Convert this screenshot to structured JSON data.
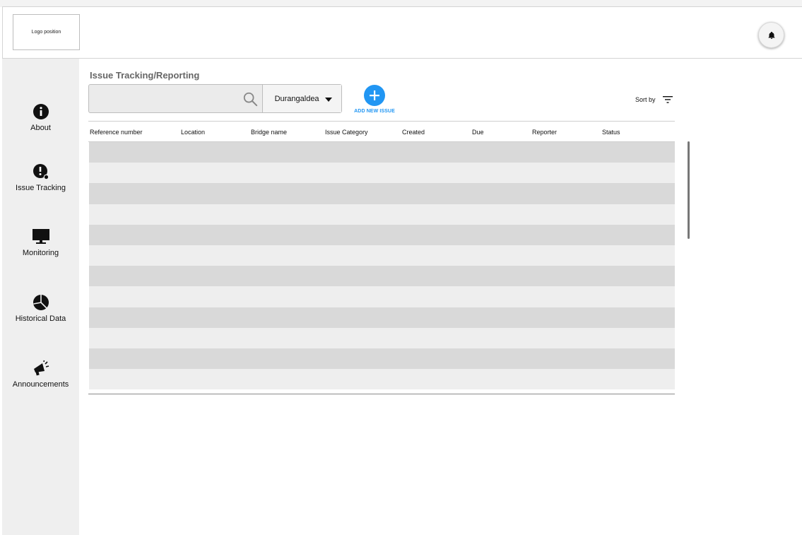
{
  "header": {
    "logo_text": "Logo position",
    "bell_icon": "bell-icon"
  },
  "sidebar": {
    "items": [
      {
        "label": "About",
        "icon": "info-icon"
      },
      {
        "label": "Issue Tracking",
        "icon": "issue-tracking-icon"
      },
      {
        "label": "Monitoring",
        "icon": "monitor-icon"
      },
      {
        "label": "Historical Data",
        "icon": "pie-chart-icon"
      },
      {
        "label": "Announcements",
        "icon": "megaphone-icon"
      }
    ]
  },
  "main": {
    "title": "Issue Tracking/Reporting",
    "search": {
      "value": "",
      "placeholder": "",
      "icon": "search-icon"
    },
    "dropdown": {
      "selected": "Durangaldea",
      "icon": "chevron-down-icon"
    },
    "add_issue": {
      "label": "ADD  NEW ISSUE",
      "icon": "plus-icon",
      "color": "#2196f3"
    },
    "sort": {
      "label": "Sort by",
      "icon": "filter-icon"
    },
    "table": {
      "columns": [
        "Reference number",
        "Location",
        "Bridge name",
        "Issue Category",
        "Created",
        "Due",
        "Reporter",
        "Status"
      ],
      "row_count": 12,
      "row_colors": [
        "#d9d9d9",
        "#eeeeee"
      ]
    }
  }
}
